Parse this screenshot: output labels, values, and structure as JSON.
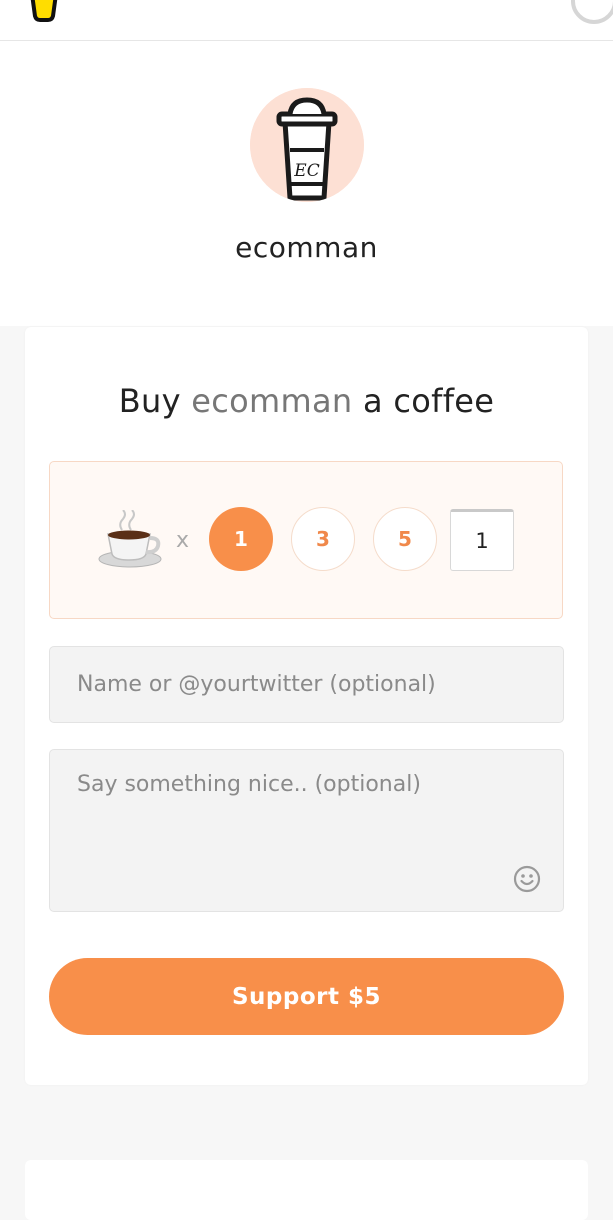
{
  "header": {
    "logo_icon": "cup-logo-icon",
    "profile_icon": "user-circle-icon"
  },
  "profile": {
    "avatar_text": "EC",
    "name": "ecomman"
  },
  "support_card": {
    "title_prefix": "Buy",
    "title_name": "ecomman",
    "title_suffix": "a coffee",
    "coffee_icon": "coffee-cup-icon",
    "times_symbol": "x",
    "quantity_options": [
      "1",
      "3",
      "5"
    ],
    "selected_quantity": "1",
    "custom_quantity_value": "1",
    "name_placeholder": "Name or @yourtwitter (optional)",
    "message_placeholder": "Say something nice.. (optional)",
    "emoji_icon": "smiley-icon",
    "support_button_label": "Support $5"
  },
  "colors": {
    "accent": "#f88f4a",
    "avatar_bg": "#fde0d4",
    "quantity_box_bg": "#fff9f5"
  }
}
